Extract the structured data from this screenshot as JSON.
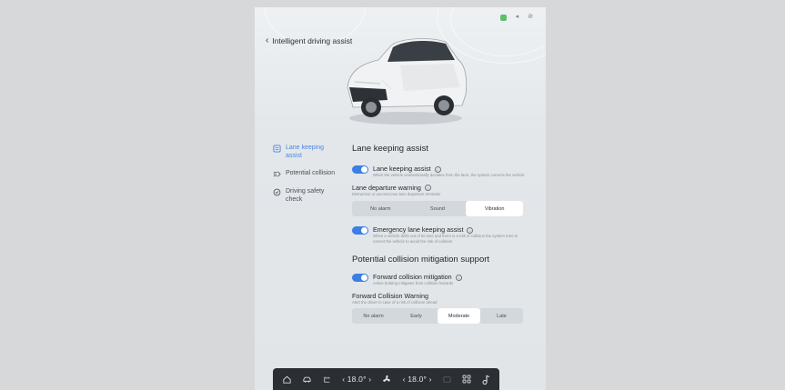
{
  "header": {
    "title": "Intelligent driving assist",
    "back_icon": "chevron-left-icon"
  },
  "status_bar": {
    "icons": [
      "signal-icon",
      "sound-icon",
      "link-icon"
    ]
  },
  "sidebar": {
    "items": [
      {
        "label": "Lane keeping assist",
        "icon": "lane-icon",
        "active": true
      },
      {
        "label": "Potential collision",
        "icon": "collision-icon",
        "active": false
      },
      {
        "label": "Driving safety check",
        "icon": "shield-check-icon",
        "active": false
      }
    ]
  },
  "sections": {
    "lane": {
      "title": "Lane keeping assist",
      "lka": {
        "label": "Lane keeping assist",
        "enabled": true,
        "desc": "When the vehicle unintentionally deviates from the lane, the system corrects the vehicle"
      },
      "ldw": {
        "label": "Lane departure warning",
        "desc": "Distraction or unconscious lane departure reminder",
        "options": [
          "No alarm",
          "Sound",
          "Vibration"
        ],
        "selected": "Vibration"
      },
      "elka": {
        "label": "Emergency lane keeping assist",
        "enabled": true,
        "desc": "When a vehicle drifts out of its lane and there is a risk of collision the system tries to correct the vehicle to avoid the risk of collision"
      }
    },
    "collision": {
      "title": "Potential collision mitigation support",
      "fcm": {
        "label": "Forward collision mitigation",
        "enabled": true,
        "desc": "Active braking mitigates from collision hazards"
      },
      "fcw": {
        "label": "Forward Collision Warning",
        "desc": "Alert the driver in case of a risk of collision ahead",
        "options": [
          "No alarm",
          "Early",
          "Moderate",
          "Late"
        ],
        "selected": "Moderate"
      }
    }
  },
  "dock": {
    "left_temp": "18.0°",
    "right_temp": "18.0°",
    "left_arrow": "‹",
    "right_arrow": "›",
    "icons": [
      "home-icon",
      "car-icon",
      "seat-heat-icon",
      "fan-icon",
      "defrost-icon",
      "apps-icon",
      "music-icon"
    ]
  },
  "colors": {
    "accent": "#3b7fe6",
    "dock": "#2b2e32",
    "background": "#d6d8da"
  }
}
